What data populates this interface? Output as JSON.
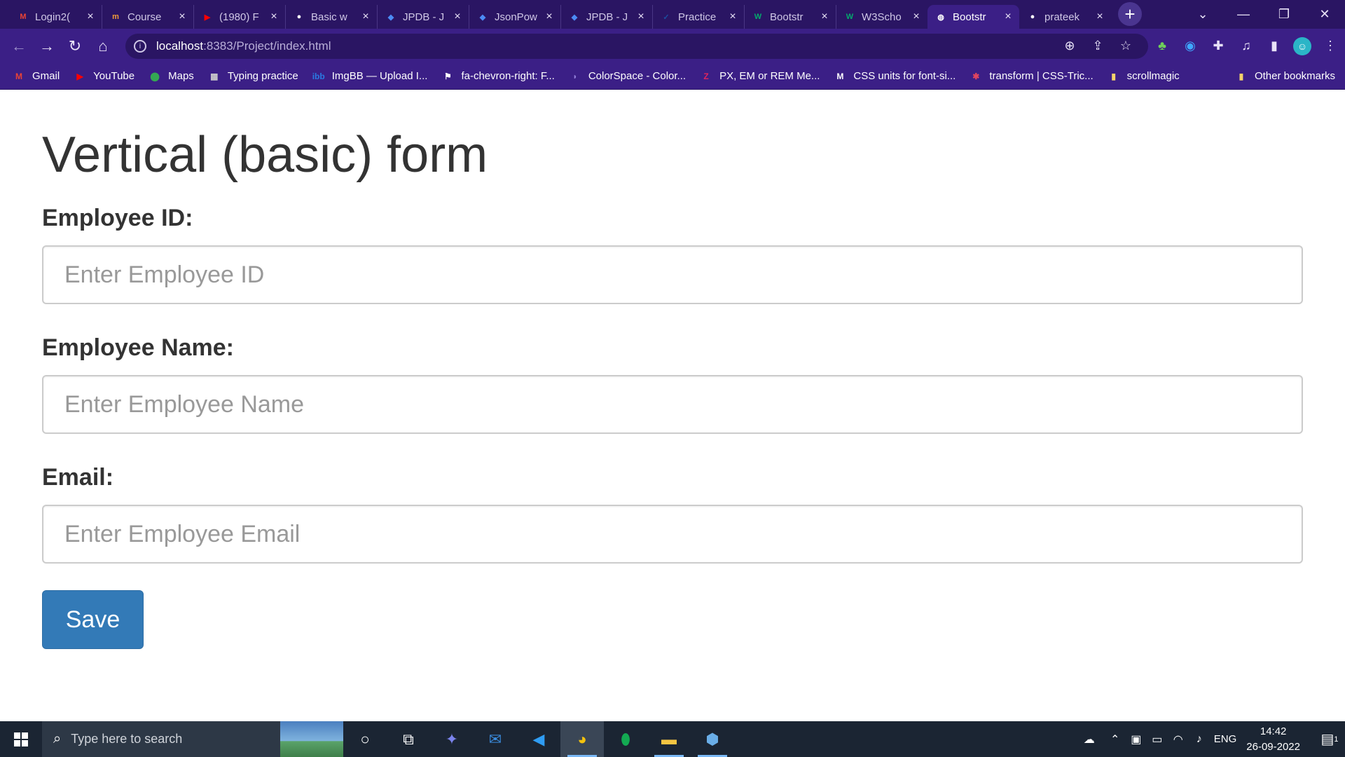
{
  "browser": {
    "tabs": [
      {
        "label": "Login2(",
        "icon": "gmail-icon",
        "color": "#ea4335",
        "glyph": "M"
      },
      {
        "label": "Course",
        "icon": "course-icon",
        "color": "#f29c38",
        "glyph": "m"
      },
      {
        "label": "(1980) F",
        "icon": "youtube-icon",
        "color": "#ff0000",
        "glyph": "▶"
      },
      {
        "label": "Basic w",
        "icon": "github-icon",
        "color": "#ffffff",
        "glyph": "●"
      },
      {
        "label": "JPDB - J",
        "icon": "jpdb-icon",
        "color": "#4c8bf5",
        "glyph": "◆"
      },
      {
        "label": "JsonPow",
        "icon": "jpdb-icon",
        "color": "#4c8bf5",
        "glyph": "◆"
      },
      {
        "label": "JPDB - J",
        "icon": "jpdb-icon",
        "color": "#4c8bf5",
        "glyph": "◆"
      },
      {
        "label": "Practice",
        "icon": "check-circle-icon",
        "color": "#1c4fa1",
        "glyph": "✓"
      },
      {
        "label": "Bootstr",
        "icon": "w3schools-icon",
        "color": "#04aa6d",
        "glyph": "W"
      },
      {
        "label": "W3Scho",
        "icon": "w3schools-icon",
        "color": "#04aa6d",
        "glyph": "W"
      },
      {
        "label": "Bootstr",
        "icon": "globe-icon",
        "color": "#ffffff",
        "glyph": "◍",
        "active": true
      },
      {
        "label": "prateek",
        "icon": "github-icon",
        "color": "#ffffff",
        "glyph": "●"
      }
    ],
    "url_host": "localhost",
    "url_rest": ":8383/Project/index.html",
    "bookmarks": [
      {
        "label": "Gmail",
        "icon": "gmail-icon",
        "color": "#ea4335",
        "glyph": "M"
      },
      {
        "label": "YouTube",
        "icon": "youtube-icon",
        "color": "#ff0000",
        "glyph": "▶"
      },
      {
        "label": "Maps",
        "icon": "maps-pin-icon",
        "color": "#34a853",
        "glyph": "⬤"
      },
      {
        "label": "Typing practice",
        "icon": "typing-icon",
        "color": "#cccccc",
        "glyph": "▦"
      },
      {
        "label": "ImgBB — Upload I...",
        "icon": "imgbb-icon",
        "color": "#2a7ae2",
        "glyph": "ibb"
      },
      {
        "label": "fa-chevron-right: F...",
        "icon": "flag-icon",
        "color": "#ffffff",
        "glyph": "⚑"
      },
      {
        "label": "ColorSpace - Color...",
        "icon": "colorspace-icon",
        "color": "#8f7bd6",
        "glyph": "◗"
      },
      {
        "label": "PX, EM or REM Me...",
        "icon": "zeta-icon",
        "color": "#e0245e",
        "glyph": "Z"
      },
      {
        "label": "CSS units for font-si...",
        "icon": "medium-icon",
        "color": "#ffffff",
        "glyph": "M"
      },
      {
        "label": "transform | CSS-Tric...",
        "icon": "asterisk-icon",
        "color": "#e2455f",
        "glyph": "✱"
      },
      {
        "label": "scrollmagic",
        "icon": "folder-icon",
        "color": "#f5d36b",
        "glyph": "▮"
      }
    ],
    "other_bookmarks": "Other bookmarks"
  },
  "page": {
    "title": "Vertical (basic) form",
    "fields": [
      {
        "label": "Employee ID:",
        "placeholder": "Enter Employee ID"
      },
      {
        "label": "Employee Name:",
        "placeholder": "Enter Employee Name"
      },
      {
        "label": "Email:",
        "placeholder": "Enter Employee Email"
      }
    ],
    "save_label": "Save"
  },
  "taskbar": {
    "search_placeholder": "Type here to search",
    "language": "ENG",
    "time": "14:42",
    "date": "26-09-2022",
    "notification_count": "1"
  }
}
